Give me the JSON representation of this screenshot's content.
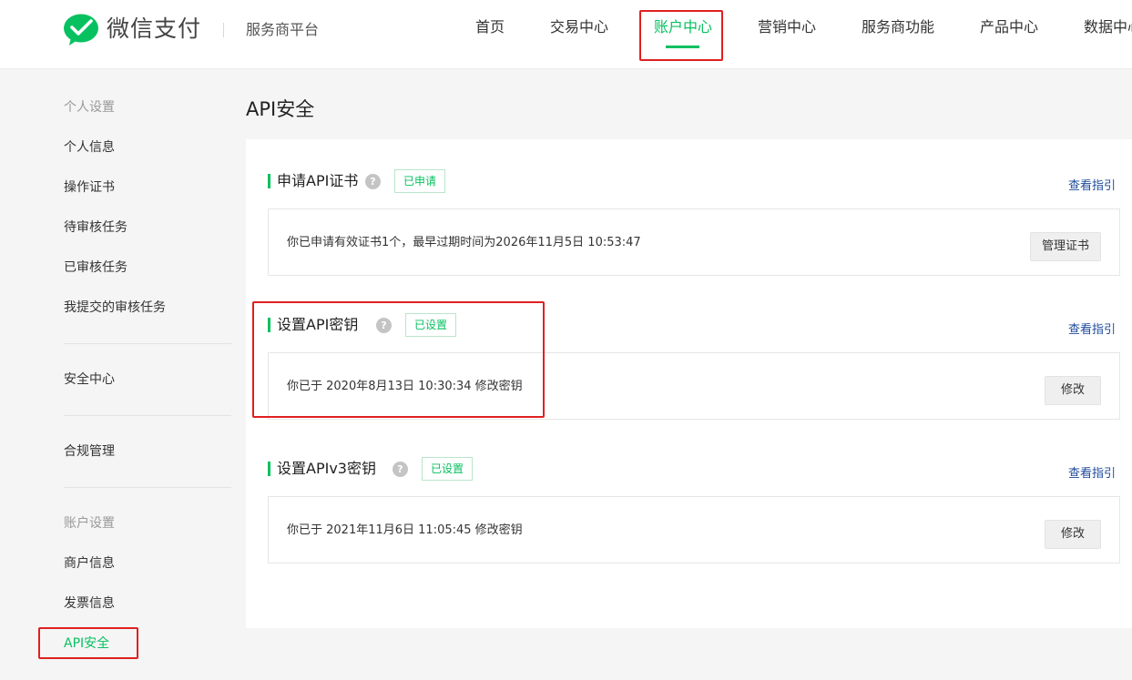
{
  "header": {
    "brand": "微信支付",
    "platform": "服务商平台",
    "nav": [
      {
        "label": "首页"
      },
      {
        "label": "交易中心"
      },
      {
        "label": "账户中心"
      },
      {
        "label": "营销中心"
      },
      {
        "label": "服务商功能"
      },
      {
        "label": "产品中心"
      },
      {
        "label": "数据中心"
      }
    ]
  },
  "sidebar": {
    "personal_group": "个人设置",
    "personal_items": [
      {
        "label": "个人信息"
      },
      {
        "label": "操作证书"
      },
      {
        "label": "待审核任务"
      },
      {
        "label": "已审核任务"
      },
      {
        "label": "我提交的审核任务"
      }
    ],
    "security_center": "安全中心",
    "compliance": "合规管理",
    "account_group": "账户设置",
    "account_items": [
      {
        "label": "商户信息"
      },
      {
        "label": "发票信息"
      },
      {
        "label": "API安全"
      }
    ]
  },
  "main": {
    "title": "API安全",
    "sections": [
      {
        "title": "申请API证书",
        "badge": "已申请",
        "guide": "查看指引",
        "info": "你已申请有效证书1个，最早过期时间为2026年11月5日 10:53:47",
        "button": "管理证书"
      },
      {
        "title": "设置API密钥",
        "badge": "已设置",
        "guide": "查看指引",
        "info": "你已于 2020年8月13日 10:30:34 修改密钥",
        "button": "修改"
      },
      {
        "title": "设置APIv3密钥",
        "badge": "已设置",
        "guide": "查看指引",
        "info": "你已于 2021年11月6日 11:05:45 修改密钥",
        "button": "修改"
      }
    ],
    "help_glyph": "?"
  },
  "colors": {
    "accent": "#07c160",
    "link": "#1d4a9a",
    "annotation": "#e02020"
  }
}
